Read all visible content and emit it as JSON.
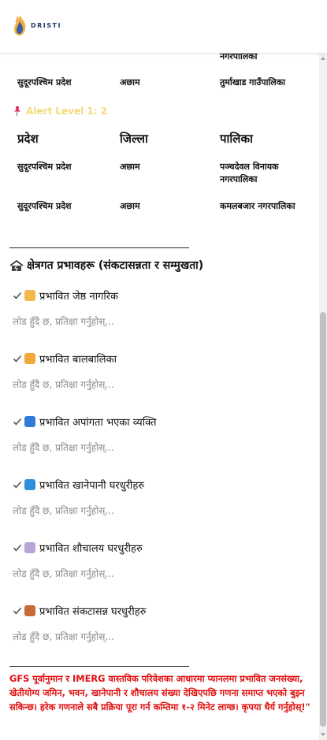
{
  "header": {
    "logo_text": "DRISTI"
  },
  "table_top_partial": {
    "row_partial_palika": "नगरपालिका",
    "row": {
      "pradesh": "सुदूरपश्चिम प्रदेश",
      "jilla": "अछाम",
      "palika": "तुर्माखाड गाउँपालिका"
    }
  },
  "alert": {
    "label": "Alert Level 1: 2",
    "color": "#f5d97a"
  },
  "table": {
    "headers": {
      "pradesh": "प्रदेश",
      "jilla": "जिल्ला",
      "palika": "पालिका"
    },
    "rows": [
      {
        "pradesh": "सुदूरपश्चिम प्रदेश",
        "jilla": "अछाम",
        "palika": "पञ्चदेवल विनायक नगरपालिका"
      },
      {
        "pradesh": "सुदूरपश्चिम प्रदेश",
        "jilla": "अछाम",
        "palika": "कमलबजार नगरपालिका"
      }
    ]
  },
  "section": {
    "title": "क्षेत्रगत प्रभावहरू (संकटासन्नता र सम्मुखता)",
    "items": [
      {
        "label": "प्रभावित जेष्ठ नागरिक",
        "icon": "elderly-icon",
        "color": "#f2b84b"
      },
      {
        "label": "प्रभावित बालबालिका",
        "icon": "child-icon",
        "color": "#f2a93b"
      },
      {
        "label": "प्रभावित अपांगता भएका व्यक्ति",
        "icon": "wheelchair-icon",
        "color": "#2f7bd8"
      },
      {
        "label": "प्रभावित खानेपानी घरधुरीहरु",
        "icon": "water-icon",
        "color": "#2f8fd8"
      },
      {
        "label": "प्रभावित शौचालय घरधुरीहरु",
        "icon": "toilet-icon",
        "color": "#b9a4d8"
      },
      {
        "label": "प्रभावित संकटासन्न घरधुरीहरु",
        "icon": "house-icon",
        "color": "#c9683b"
      }
    ],
    "loading_text": "लोड हुँदै छ, प्रतिक्षा गर्नुहोस्..."
  },
  "note": "GFS पूर्वानुमान र IMERG वास्तविक परिवेशका आधारमा प्यानलमा प्रभावित जनसंख्या, खेतीयोग्य जमिन, भवन, खानेपानी र शौचालय संख्या देखिएपछि गणना समाप्त भएको बुझ्न सकिन्छ। हरेक गणनाले सबै प्रक्रिया पूरा गर्न कम्तिमा १-२ मिनेट लाग्छ। कृपया धैर्य गर्नुहोस्!\""
}
